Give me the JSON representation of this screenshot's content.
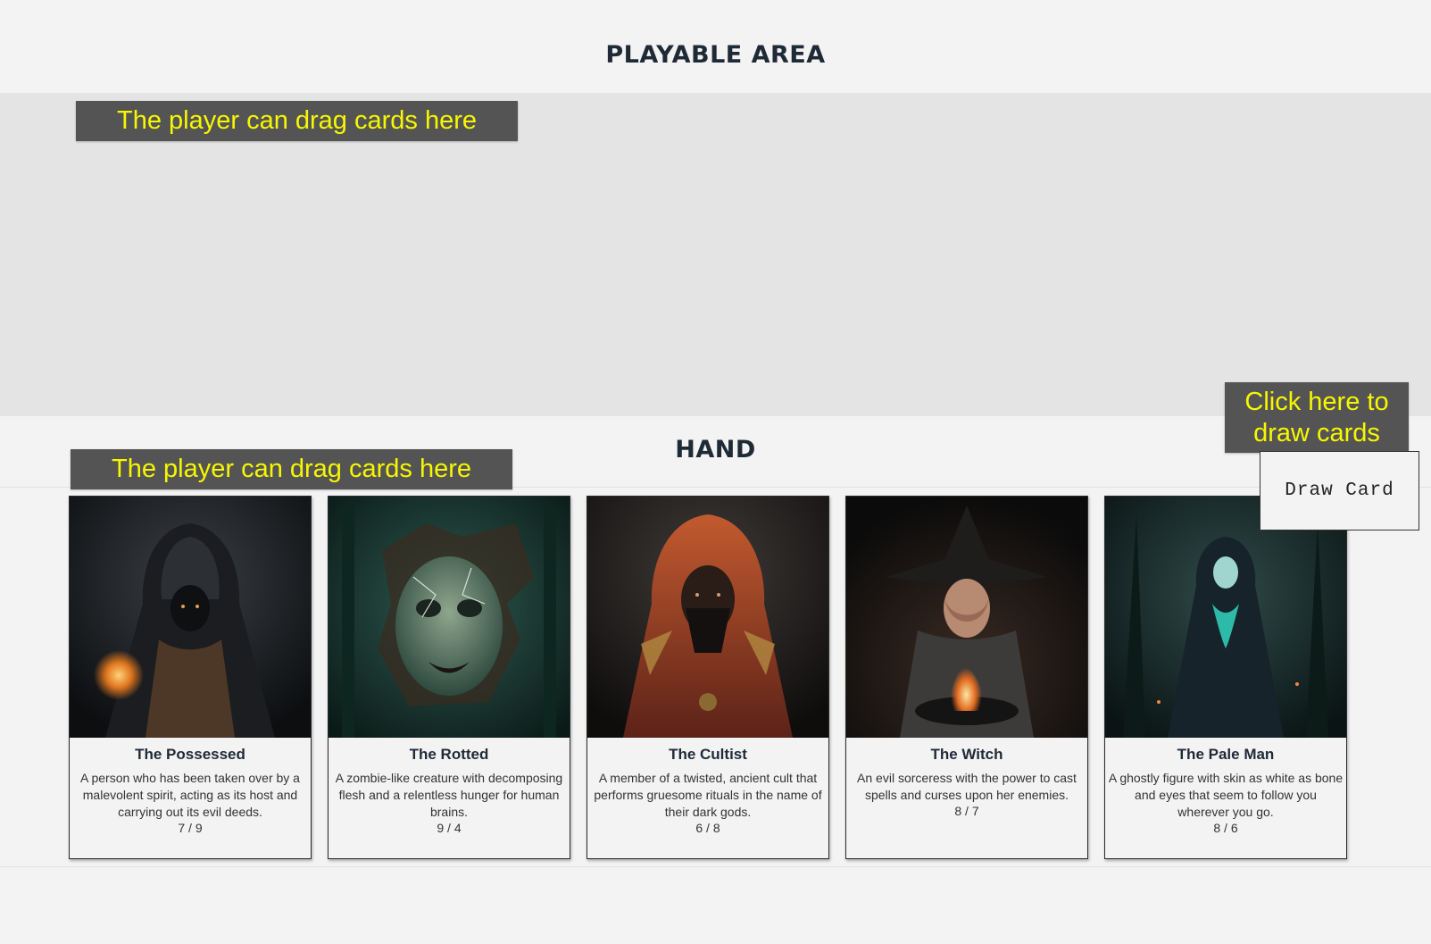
{
  "playable": {
    "title": "PLAYABLE AREA",
    "hint": "The player can drag cards here"
  },
  "hand": {
    "title": "HAND",
    "hint": "The player can drag cards here"
  },
  "draw": {
    "hint_line1": "Click here to",
    "hint_line2": "draw cards",
    "button_label": "Draw Card"
  },
  "colors": {
    "hint_bg": "#545454",
    "hint_text": "#f7f700",
    "play_bg": "#e4e4e4",
    "page_bg": "#f3f3f3"
  },
  "cards": [
    {
      "name": "The Possessed",
      "description": "A person who has been taken over by a malevolent spirit, acting as its host and carrying out its evil deeds.",
      "stats": "7 / 9",
      "art": "hooded-figure-with-flame"
    },
    {
      "name": "The Rotted",
      "description": "A zombie-like creature with decomposing flesh and a relentless hunger for human brains.",
      "stats": "9 / 4",
      "art": "zombie-face"
    },
    {
      "name": "The Cultist",
      "description": "A member of a twisted, ancient cult that performs gruesome rituals in the name of their dark gods.",
      "stats": "6 / 8",
      "art": "masked-hooded-cultist"
    },
    {
      "name": "The Witch",
      "description": "An evil sorceress with the power to cast spells and curses upon her enemies.",
      "stats": "8 / 7",
      "art": "witch-with-cauldron"
    },
    {
      "name": "The Pale Man",
      "description": "A ghostly figure with skin as white as bone and eyes that seem to follow you wherever you go.",
      "stats": "8 / 6",
      "art": "ghostly-figure-in-forest"
    }
  ]
}
